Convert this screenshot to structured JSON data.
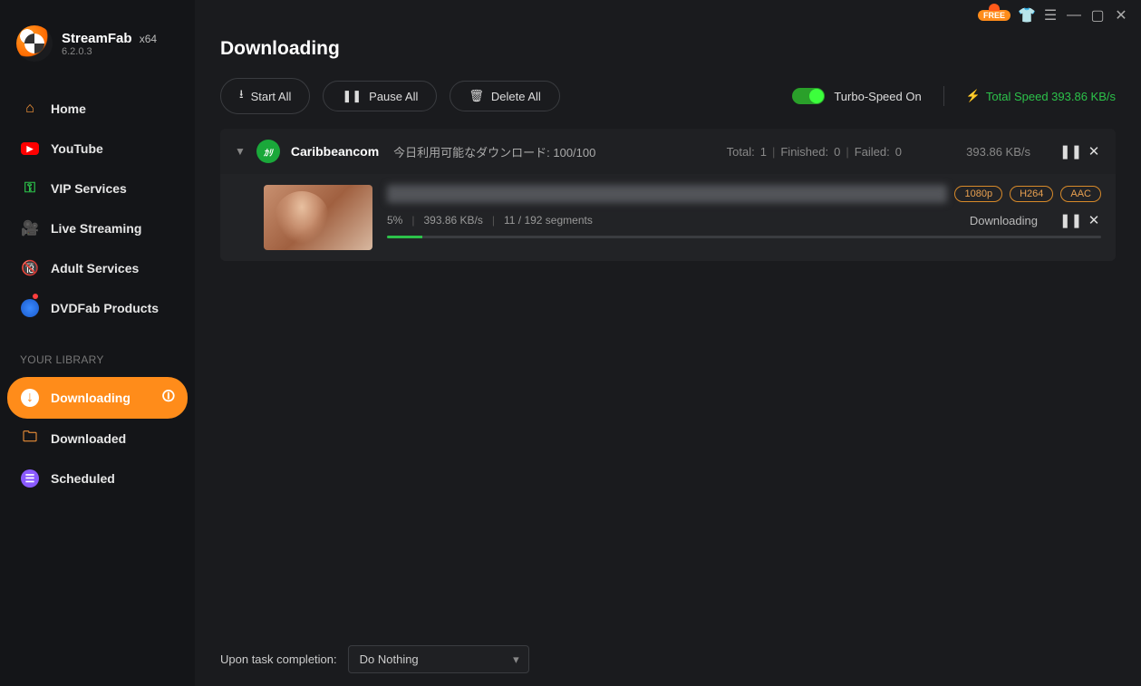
{
  "app": {
    "name": "StreamFab",
    "arch": "x64",
    "version": "6.2.0.3"
  },
  "titlebar": {
    "free_label": "FREE"
  },
  "sidebar": {
    "items": [
      {
        "label": "Home"
      },
      {
        "label": "YouTube"
      },
      {
        "label": "VIP Services"
      },
      {
        "label": "Live Streaming"
      },
      {
        "label": "Adult Services"
      },
      {
        "label": "DVDFab Products"
      }
    ],
    "library_label": "YOUR LIBRARY",
    "library": [
      {
        "label": "Downloading"
      },
      {
        "label": "Downloaded"
      },
      {
        "label": "Scheduled"
      }
    ]
  },
  "page": {
    "title": "Downloading"
  },
  "toolbar": {
    "start_all": "Start All",
    "pause_all": "Pause All",
    "delete_all": "Delete All",
    "turbo_label": "Turbo-Speed On",
    "total_speed_label": "Total Speed 393.86 KB/s"
  },
  "group": {
    "service": "Caribbeancom",
    "subtitle": "今日利用可能なダウンロード: 100/100",
    "total_label": "Total:",
    "total": "1",
    "finished_label": "Finished:",
    "finished": "0",
    "failed_label": "Failed:",
    "failed": "0",
    "speed": "393.86 KB/s"
  },
  "item": {
    "tags": {
      "res": "1080p",
      "vcodec": "H264",
      "acodec": "AAC"
    },
    "percent": "5%",
    "speed": "393.86 KB/s",
    "segments": "11 / 192 segments",
    "status": "Downloading",
    "progress_pct": 5
  },
  "footer": {
    "label": "Upon task completion:",
    "selected": "Do Nothing"
  }
}
